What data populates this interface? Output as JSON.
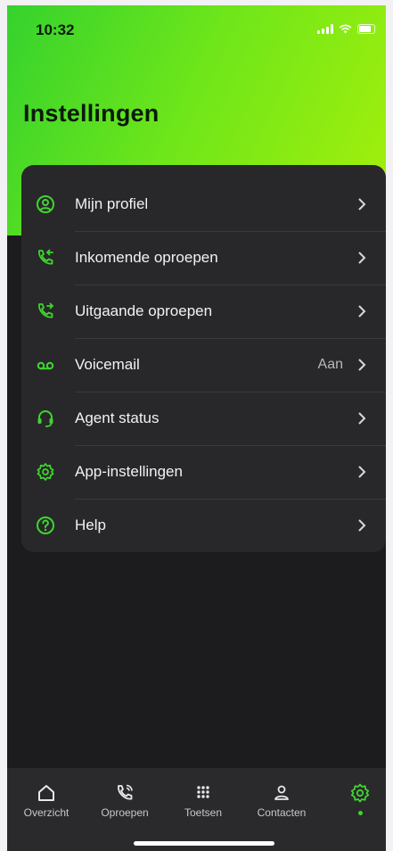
{
  "status_bar": {
    "time": "10:32"
  },
  "header": {
    "title": "Instellingen"
  },
  "menu": {
    "items": [
      {
        "label": "Mijn profiel",
        "icon": "profile-icon",
        "value": ""
      },
      {
        "label": "Inkomende oproepen",
        "icon": "incoming-call-icon",
        "value": ""
      },
      {
        "label": "Uitgaande oproepen",
        "icon": "outgoing-call-icon",
        "value": ""
      },
      {
        "label": "Voicemail",
        "icon": "voicemail-icon",
        "value": "Aan"
      },
      {
        "label": "Agent status",
        "icon": "headset-icon",
        "value": ""
      },
      {
        "label": "App-instellingen",
        "icon": "gear-icon",
        "value": ""
      },
      {
        "label": "Help",
        "icon": "help-icon",
        "value": ""
      }
    ]
  },
  "bottom_nav": {
    "tabs": [
      {
        "label": "Overzicht",
        "icon": "home-icon"
      },
      {
        "label": "Oproepen",
        "icon": "phone-icon"
      },
      {
        "label": "Toetsen",
        "icon": "keypad-icon"
      },
      {
        "label": "Contacten",
        "icon": "contact-icon"
      },
      {
        "label": "",
        "icon": "settings-icon",
        "active": true
      }
    ]
  },
  "colors": {
    "accent": "#3fd52f",
    "background": "#1c1c1e",
    "card": "#28282a"
  }
}
